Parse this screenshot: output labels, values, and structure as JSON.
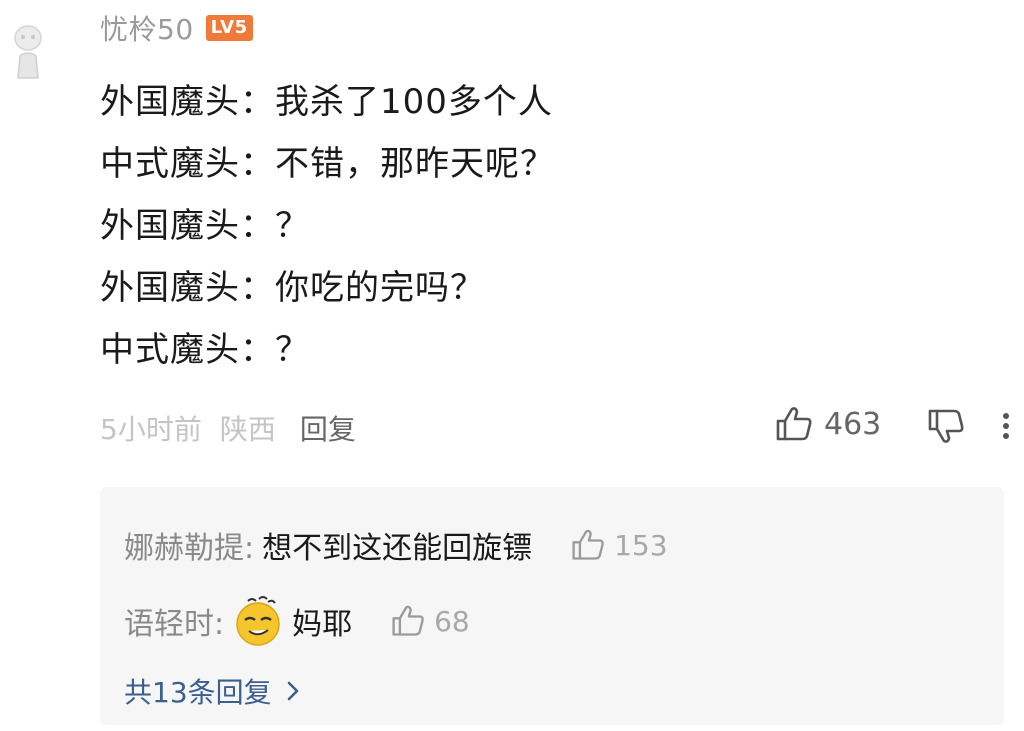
{
  "comment": {
    "username": "忧柃50",
    "level_badge": "LV5",
    "lines": [
      "外国魔头：我杀了100多个人",
      "中式魔头：不错，那昨天呢？",
      "外国魔头：？",
      "外国魔头：你吃的完吗？",
      "中式魔头：？"
    ],
    "time": "5小时前",
    "location": "陕西",
    "reply_label": "回复",
    "like_count": "463",
    "icons": {
      "like": "thumbs-up-icon",
      "dislike": "thumbs-down-icon",
      "more": "vertical-ellipsis-icon"
    }
  },
  "replies": [
    {
      "author": "娜赫勒提:",
      "text": "想不到这还能回旋镖",
      "like_count": "153"
    },
    {
      "author": "语轻时:",
      "emoji": "smirking-face-emoji",
      "text": "妈耶",
      "like_count": "68"
    }
  ],
  "replies_footer": {
    "label": "共13条回复",
    "icon": "chevron-right-icon"
  },
  "colors": {
    "level_badge": "#f07a3a",
    "link_blue": "#3b5f8f",
    "reply_bg": "#f6f6f6"
  }
}
